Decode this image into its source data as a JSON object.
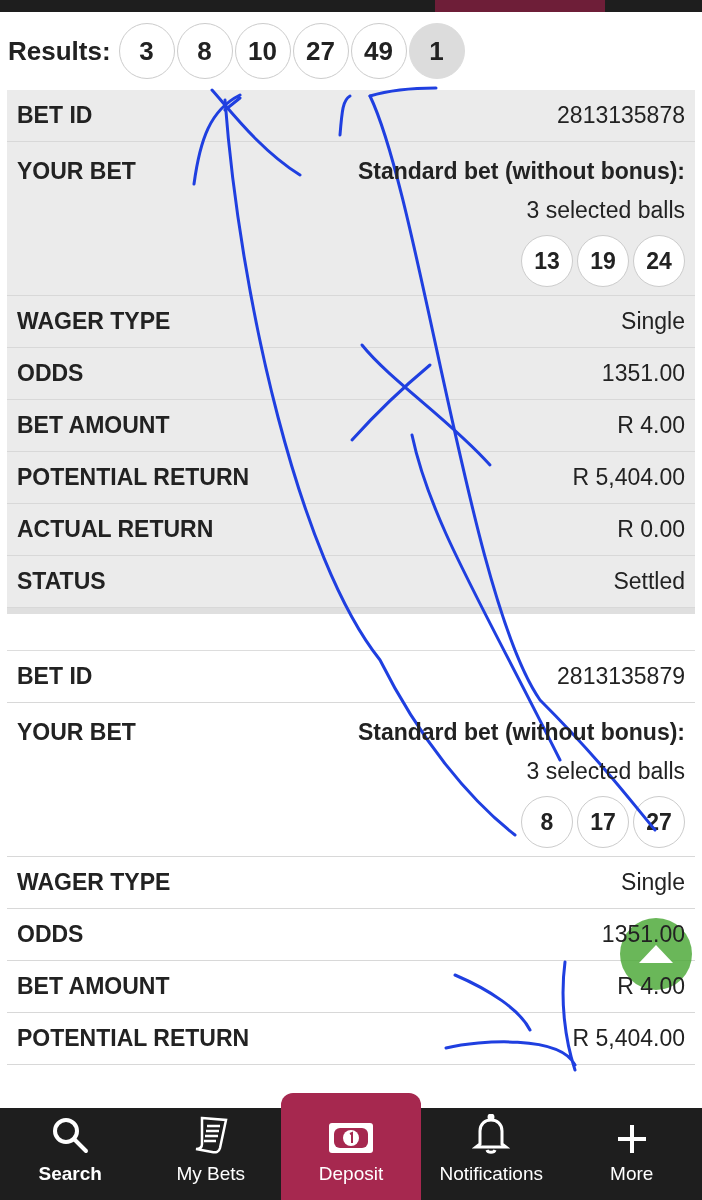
{
  "results": {
    "label": "Results:",
    "balls": [
      {
        "number": "3",
        "bonus": false
      },
      {
        "number": "8",
        "bonus": false
      },
      {
        "number": "10",
        "bonus": false
      },
      {
        "number": "27",
        "bonus": false
      },
      {
        "number": "49",
        "bonus": false
      },
      {
        "number": "1",
        "bonus": true
      }
    ]
  },
  "bets": [
    {
      "shaded": true,
      "rows": [
        {
          "kind": "text",
          "label": "BET ID",
          "value": "2813135878"
        },
        {
          "kind": "balls",
          "label": "YOUR BET",
          "value": "Standard bet (without bonus):",
          "detail": "3 selected balls",
          "balls": [
            "13",
            "19",
            "24"
          ]
        },
        {
          "kind": "text",
          "label": "WAGER TYPE",
          "value": "Single"
        },
        {
          "kind": "text",
          "label": "ODDS",
          "value": "1351.00"
        },
        {
          "kind": "text",
          "label": "BET AMOUNT",
          "value": "R 4.00"
        },
        {
          "kind": "text",
          "label": "POTENTIAL RETURN",
          "value": "R 5,404.00"
        },
        {
          "kind": "text",
          "label": "ACTUAL RETURN",
          "value": "R 0.00"
        },
        {
          "kind": "text",
          "label": "STATUS",
          "value": "Settled"
        }
      ]
    },
    {
      "shaded": false,
      "rows": [
        {
          "kind": "text",
          "label": "BET ID",
          "value": "2813135879"
        },
        {
          "kind": "balls",
          "label": "YOUR BET",
          "value": "Standard bet (without bonus):",
          "detail": "3 selected balls",
          "balls": [
            "8",
            "17",
            "27"
          ]
        },
        {
          "kind": "text",
          "label": "WAGER TYPE",
          "value": "Single"
        },
        {
          "kind": "text",
          "label": "ODDS",
          "value": "1351.00"
        },
        {
          "kind": "text",
          "label": "BET AMOUNT",
          "value": "R 4.00"
        },
        {
          "kind": "text",
          "label": "POTENTIAL RETURN",
          "value": "R 5,404.00"
        }
      ]
    }
  ],
  "nav": [
    {
      "label": "Search",
      "current": true,
      "selected": false
    },
    {
      "label": "My Bets",
      "current": false,
      "selected": false
    },
    {
      "label": "Deposit",
      "current": false,
      "selected": true
    },
    {
      "label": "Notifications",
      "current": false,
      "selected": false
    },
    {
      "label": "More",
      "current": false,
      "selected": false
    }
  ]
}
